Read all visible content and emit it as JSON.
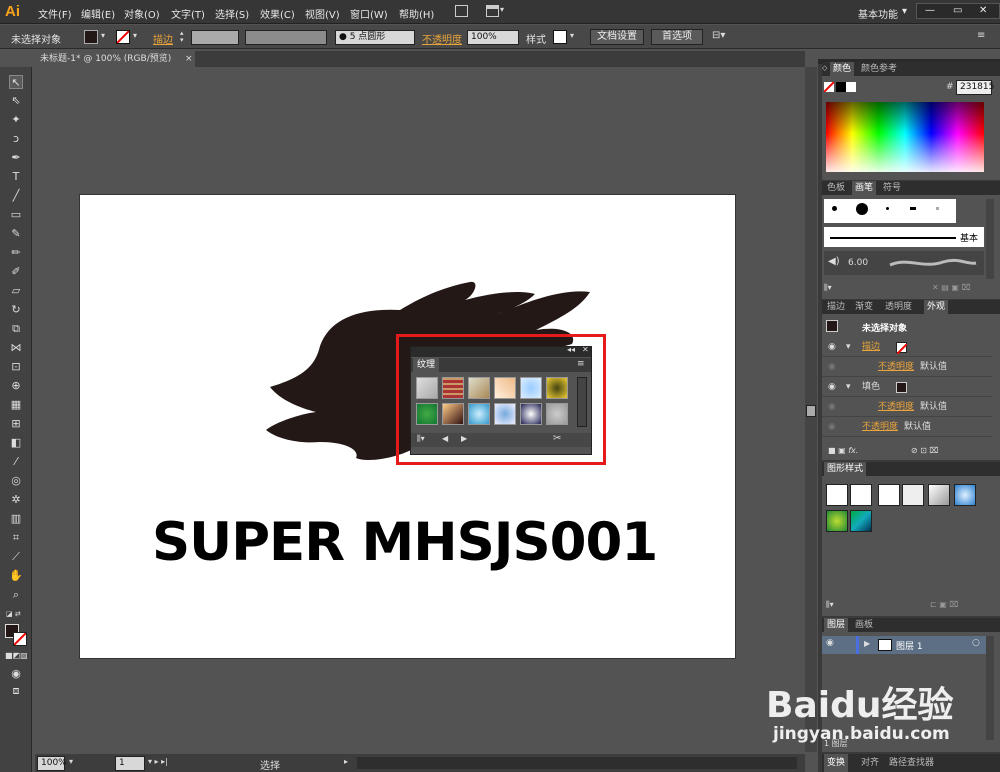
{
  "app": {
    "logo": "Ai",
    "workspace": "基本功能"
  },
  "menu": [
    "文件(F)",
    "编辑(E)",
    "对象(O)",
    "文字(T)",
    "选择(S)",
    "效果(C)",
    "视图(V)",
    "窗口(W)",
    "帮助(H)"
  ],
  "control": {
    "selection": "未选择对象",
    "stroke_label": "描边",
    "brush_value": "5 点圆形",
    "opacity_label": "不透明度",
    "opacity_value": "100%",
    "style_label": "样式",
    "doc_setup": "文档设置",
    "prefs": "首选项"
  },
  "document": {
    "tab": "未标题-1* @ 100% (RGB/预览)",
    "close": "×"
  },
  "artwork": {
    "text": "SUPER MHSJS001",
    "splash_color": "#231815"
  },
  "texture_panel": {
    "tab": "纹理"
  },
  "status": {
    "zoom": "100%",
    "page": "1",
    "mode": "选择"
  },
  "color_panel": {
    "tabs": [
      "颜色",
      "颜色参考"
    ],
    "hex_label": "#",
    "hex": "231815"
  },
  "brush_panel": {
    "tabs": [
      "色板",
      "画笔",
      "符号"
    ],
    "basic": "基本",
    "size": "6.00"
  },
  "appearance_panel": {
    "tabs": [
      "描边",
      "渐变",
      "透明度",
      "外观"
    ],
    "title": "未选择对象",
    "stroke": "描边",
    "opacity1": "不透明度",
    "default1": "默认值",
    "fill": "填色",
    "opacity2": "不透明度",
    "default2": "默认值",
    "opacity3": "不透明度",
    "default3": "默认值",
    "fx": "fx."
  },
  "graphic_styles": {
    "tab": "图形样式"
  },
  "layers_panel": {
    "tabs": [
      "图层",
      "画板"
    ],
    "layer": "图层 1",
    "footer": "1 图层"
  },
  "bottom_tabs": [
    "变换",
    "对齐",
    "路径查找器"
  ],
  "watermark": {
    "brand": "Baidu经验",
    "url": "jingyan.baidu.com"
  }
}
